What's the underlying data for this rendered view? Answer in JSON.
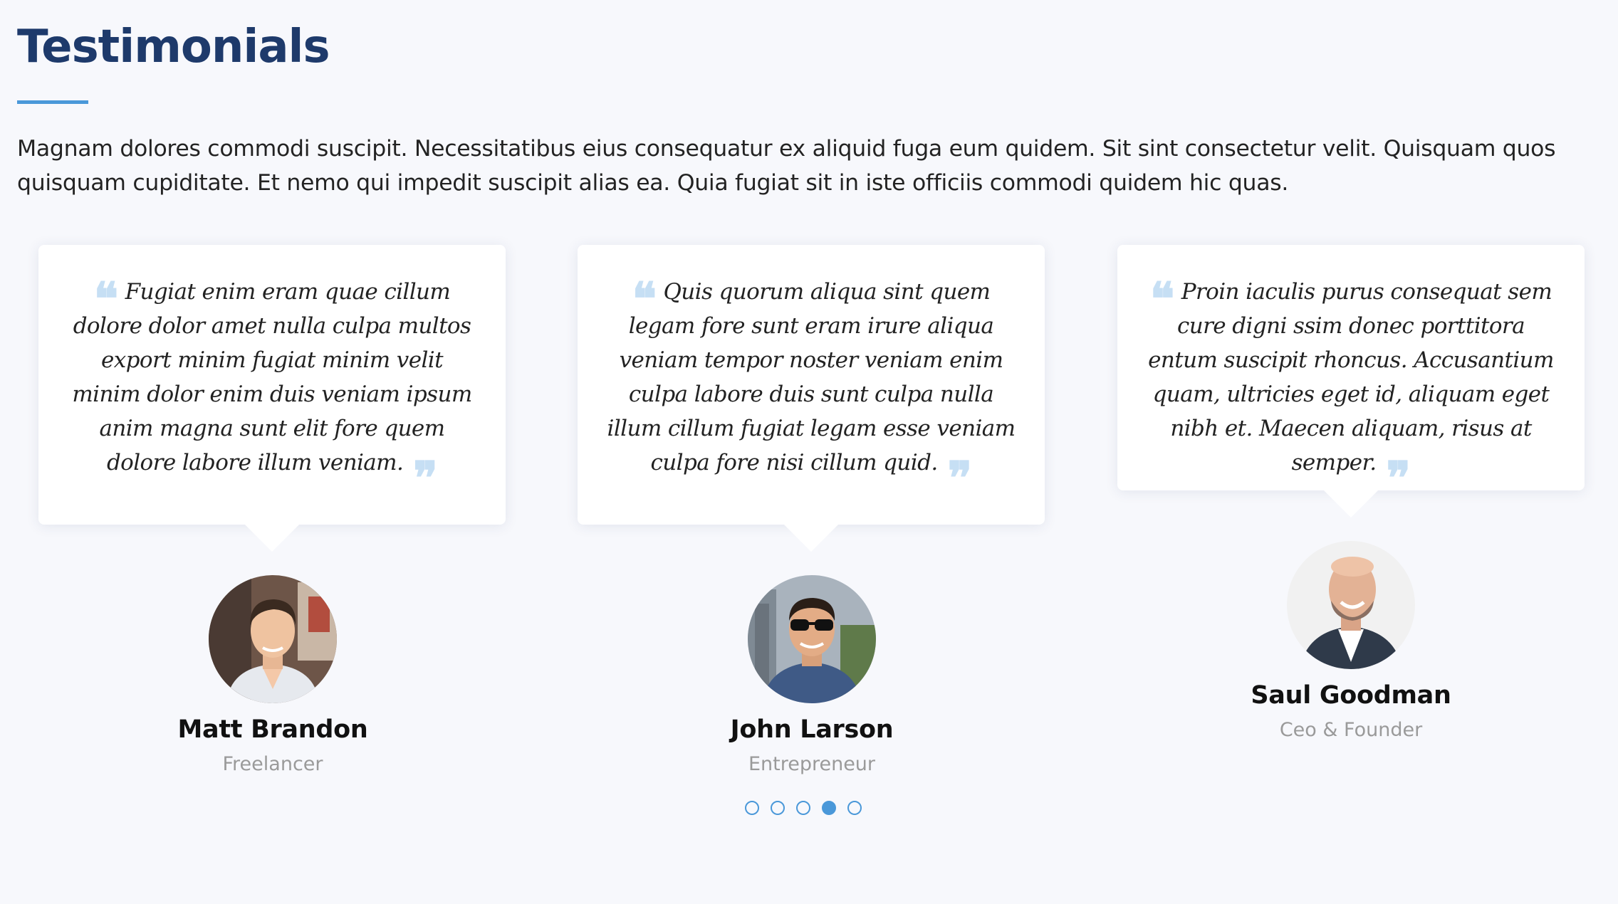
{
  "section": {
    "title": "Testimonials",
    "intro": "Magnam dolores commodi suscipit. Necessitatibus eius consequatur ex aliquid fuga eum quidem. Sit sint consectetur velit. Quisquam quos quisquam cupiditate. Et nemo qui impedit suscipit alias ea. Quia fugiat sit in iste officiis commodi quidem hic quas."
  },
  "testimonials": [
    {
      "quote": "Fugiat enim eram quae cillum dolore dolor amet nulla culpa multos export minim fugiat minim velit minim dolor enim duis veniam ipsum anim magna sunt elit fore quem dolore labore illum veniam.",
      "name": "Matt Brandon",
      "role": "Freelancer"
    },
    {
      "quote": "Quis quorum aliqua sint quem legam fore sunt eram irure aliqua veniam tempor noster veniam enim culpa labore duis sunt culpa nulla illum cillum fugiat legam esse veniam culpa fore nisi cillum quid.",
      "name": "John Larson",
      "role": "Entrepreneur"
    },
    {
      "quote": "Proin iaculis purus consequat sem cure digni ssim donec porttitora entum suscipit rhoncus. Accusantium quam, ultricies eget id, aliquam eget nibh et. Maecen aliquam, risus at semper.",
      "name": "Saul Goodman",
      "role": "Ceo & Founder"
    }
  ],
  "quote_marks": {
    "open": "❝",
    "close": "❞"
  },
  "pagination": {
    "total": 5,
    "active_index": 3
  },
  "colors": {
    "title": "#1e3a6b",
    "accent": "#4a98d9",
    "background": "#f7f8fc",
    "quote_mark": "#c6dff4",
    "role_text": "#9a9a9a"
  }
}
